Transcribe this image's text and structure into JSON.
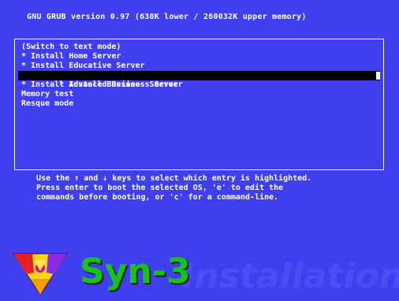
{
  "header": {
    "text": "GNU GRUB  version 0.97  (638K lower / 260032K upper memory)"
  },
  "menu": {
    "items": [
      {
        "label": "(Switch to text mode)",
        "selected": false
      },
      {
        "label": "* Install Home Server",
        "selected": false
      },
      {
        "label": "* Install Educative Server",
        "selected": false
      },
      {
        "label": "* Install Business Server",
        "selected": true
      },
      {
        "label": "* Install Advanced Business Server",
        "selected": false
      },
      {
        "label": "Memory test",
        "selected": false
      },
      {
        "label": "Resque mode",
        "selected": false
      }
    ]
  },
  "help": {
    "line1": "Use the ↑ and ↓ keys to select which entry is highlighted.",
    "line2": "Press enter to boot the selected OS, 'e' to edit the",
    "line3": "commands before booting, or 'c' for a command-line."
  },
  "branding": {
    "logo_icon": "syn3-triangle-logo-icon",
    "name": "Syn-3",
    "subtitle": "Installation"
  },
  "colors": {
    "background": "#3f3ff0",
    "text": "#ffffff",
    "selection_bg": "#000000",
    "brand_green": "#16c21b"
  }
}
